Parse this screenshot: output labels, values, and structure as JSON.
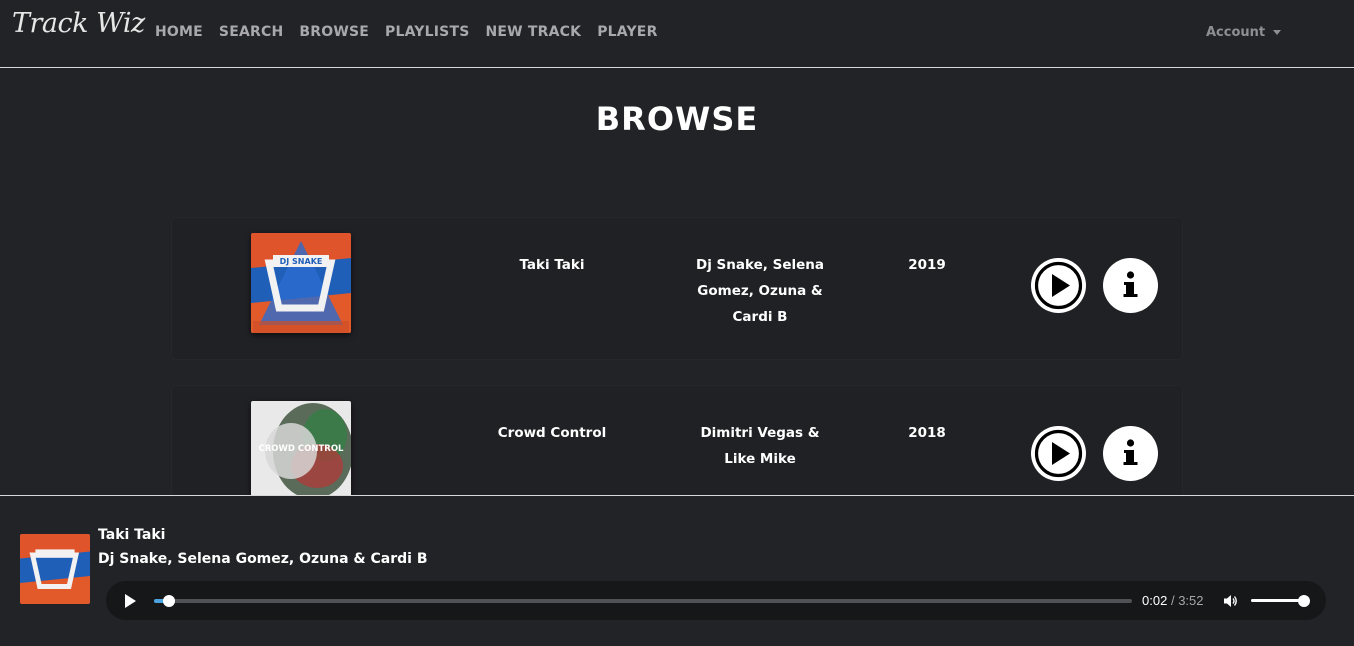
{
  "brand": "Track Wiz",
  "nav": {
    "links": [
      "HOME",
      "SEARCH",
      "BROWSE",
      "PLAYLISTS",
      "NEW TRACK",
      "PLAYER"
    ],
    "account_label": "Account"
  },
  "page": {
    "title": "BROWSE"
  },
  "tracks": [
    {
      "title": "Taki Taki",
      "artist": "Dj Snake, Selena Gomez, Ozuna & Cardi B",
      "year": "2019",
      "cover_label": "DJ SNAKE"
    },
    {
      "title": "Crowd Control",
      "artist": "Dimitri Vegas & Like Mike",
      "year": "2018",
      "cover_label": "CROWD CONTROL"
    }
  ],
  "player": {
    "title": "Taki Taki",
    "artist": "Dj Snake, Selena Gomez, Ozuna & Cardi B",
    "current_time": "0:02",
    "separator": "/",
    "duration": "3:52",
    "progress": 0.015,
    "volume": 1.0
  },
  "colors": {
    "background": "#222327",
    "accent": "#4aa3df",
    "nav_text": "#a9a9ad"
  }
}
